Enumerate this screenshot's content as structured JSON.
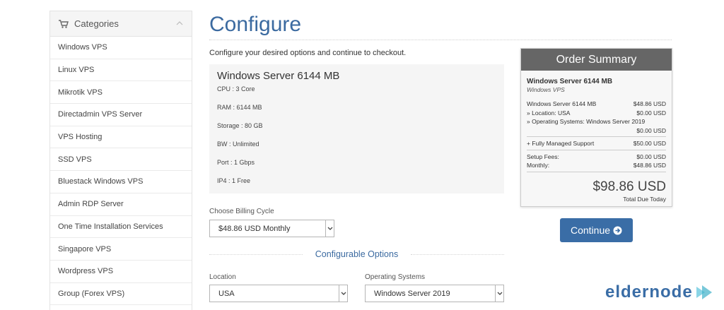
{
  "sidebar": {
    "title": "Categories",
    "items": [
      "Windows VPS",
      "Linux VPS",
      "Mikrotik VPS",
      "Directadmin VPS Server",
      "VPS Hosting",
      "SSD VPS",
      "Bluestack Windows VPS",
      "Admin RDP Server",
      "One Time Installation Services",
      "Singapore VPS",
      "Wordpress VPS",
      "Group (Forex VPS)"
    ]
  },
  "main": {
    "title": "Configure",
    "intro": "Configure your desired options and continue to checkout.",
    "product": {
      "name": "Windows Server 6144 MB",
      "specs": [
        "CPU : 3 Core",
        "RAM : 6144 MB",
        "Storage : 80 GB",
        "BW : Unlimited",
        "Port : 1 Gbps",
        "IP4 : 1 Free"
      ]
    },
    "billing": {
      "label": "Choose Billing Cycle",
      "value": "$48.86 USD Monthly"
    },
    "configurable_title": "Configurable Options",
    "location": {
      "label": "Location",
      "value": "USA"
    },
    "os": {
      "label": "Operating Systems",
      "value": "Windows Server 2019"
    }
  },
  "summary": {
    "title": "Order Summary",
    "product_name": "Windows Server 6144 MB",
    "group": "Windows VPS",
    "lines": {
      "product": {
        "label": "Windows Server 6144 MB",
        "value": "$48.86 USD"
      },
      "location": {
        "label": "» Location: USA",
        "value": "$0.00 USD"
      },
      "os": {
        "label": "» Operating Systems: Windows Server 2019",
        "value": "$0.00 USD"
      },
      "support": {
        "label": "+ Fully Managed Support",
        "value": "$50.00 USD"
      },
      "setup": {
        "label": "Setup Fees:",
        "value": "$0.00 USD"
      },
      "monthly": {
        "label": "Monthly:",
        "value": "$48.86 USD"
      }
    },
    "total": "$98.86 USD",
    "total_label": "Total Due Today"
  },
  "continue_label": "Continue",
  "logo": {
    "text": "eldernode"
  },
  "colors": {
    "accent": "#3a6da6",
    "summary_header": "#666666"
  }
}
